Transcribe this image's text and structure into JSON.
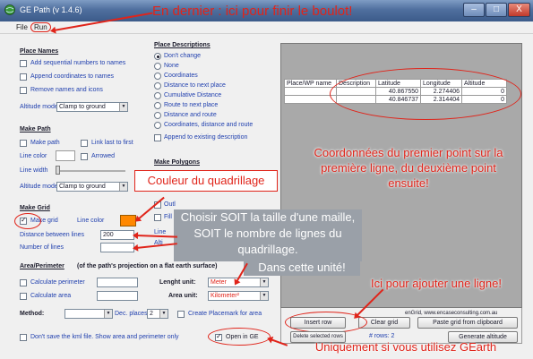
{
  "window": {
    "title": "GE Path (v 1.4.6)",
    "controls": {
      "minimize": "–",
      "maximize": "□",
      "close": "X"
    }
  },
  "menu": {
    "file": "File",
    "run": "Run"
  },
  "place_names": {
    "title": "Place Names",
    "add_numbers": "Add sequential numbers to names",
    "append_coords": "Append coordinates to names",
    "remove_names": "Remove names and icons",
    "altitude_label": "Altitude mode:",
    "altitude_value": "Clamp to ground"
  },
  "place_descriptions": {
    "title": "Place Descriptions",
    "options": [
      "Don't change",
      "None",
      "Coordinates",
      "Distance to next place",
      "Cumulative Distance",
      "Route to next place",
      "Distance and route",
      "Coordinates, distance and route"
    ],
    "append": "Append to existing description"
  },
  "make_path": {
    "title": "Make Path",
    "make_path": "Make path",
    "link_last": "Link last to first",
    "line_color": "Line color",
    "arrowed": "Arrowed",
    "line_width": "Line width",
    "altitude_label": "Altitude mode:",
    "altitude_value": "Clamp to ground"
  },
  "make_polygons": {
    "title": "Make Polygons",
    "outline": "Outl",
    "fill": "Fill",
    "line": "Line",
    "alt": "Alti"
  },
  "make_grid": {
    "title": "Make Grid",
    "make_grid": "Make grid",
    "line_color": "Line color",
    "distance_label": "Distance between lines",
    "distance_value": "200",
    "number_label": "Number of lines",
    "number_value": ""
  },
  "area_perimeter": {
    "title": "Area/Perimeter",
    "note": "(of the path's projection on a flat earth surface)",
    "calc_perimeter": "Calculate perimeter",
    "calc_area": "Calculate area",
    "length_unit_label": "Lenght unit:",
    "length_unit_value": "Meter",
    "area_unit_label": "Area unit:",
    "area_unit_value": "Kilometer²",
    "method_label": "Method:",
    "dec_places_label": "Dec. places",
    "dec_places_value": "2",
    "placemark_label": "Create Placemark for area"
  },
  "footer": {
    "dont_save": "Don't save the kml file. Show area and perimeter only",
    "open_in_ge": "Open in GE"
  },
  "grid_table": {
    "columns": [
      "Place/WP name",
      "Description",
      "Latitude",
      "Longitude",
      "Altitude"
    ],
    "rows": [
      [
        "",
        "",
        "40.867550",
        "2.274406",
        "0"
      ],
      [
        "",
        "",
        "40.846737",
        "2.314404",
        "0"
      ]
    ]
  },
  "grid_panel": {
    "credit": "enGrid, www.encaseconsulting.com.au",
    "insert_row": "Insert row",
    "clear_grid": "Clear grid",
    "paste_grid": "Paste grid from clipboard",
    "delete_selected": "Delete selected rows",
    "rows_count": "# rows: 2",
    "generate_altitude": "Generate altitude"
  },
  "annotations": {
    "top": "En dernier : ici pour finir le boulot!",
    "coords": "Coordonnées du premier point sur la première ligne, du deuxième point ensuite!",
    "grid_color": "Couleur du quadrillage",
    "grid_size": "Choisir SOIT la taille d'une maille, SOIT le nombre de lignes du quadrillage.",
    "unit": "Dans cette unité!",
    "add_row": "Ici pour ajouter une ligne!",
    "gearth": "Uniquement si vous utilisez GEarth"
  },
  "colors": {
    "annotation": "#e0241a",
    "grid_line_color": "#ff8800",
    "path_line_color": "#ffffff",
    "panel_bg": "#a9a9a9",
    "titlebar": "#4f6f9e"
  },
  "icons": [
    "app-globe-icon",
    "minimize-icon",
    "maximize-icon",
    "close-icon",
    "dropdown-arrow-icon"
  ]
}
